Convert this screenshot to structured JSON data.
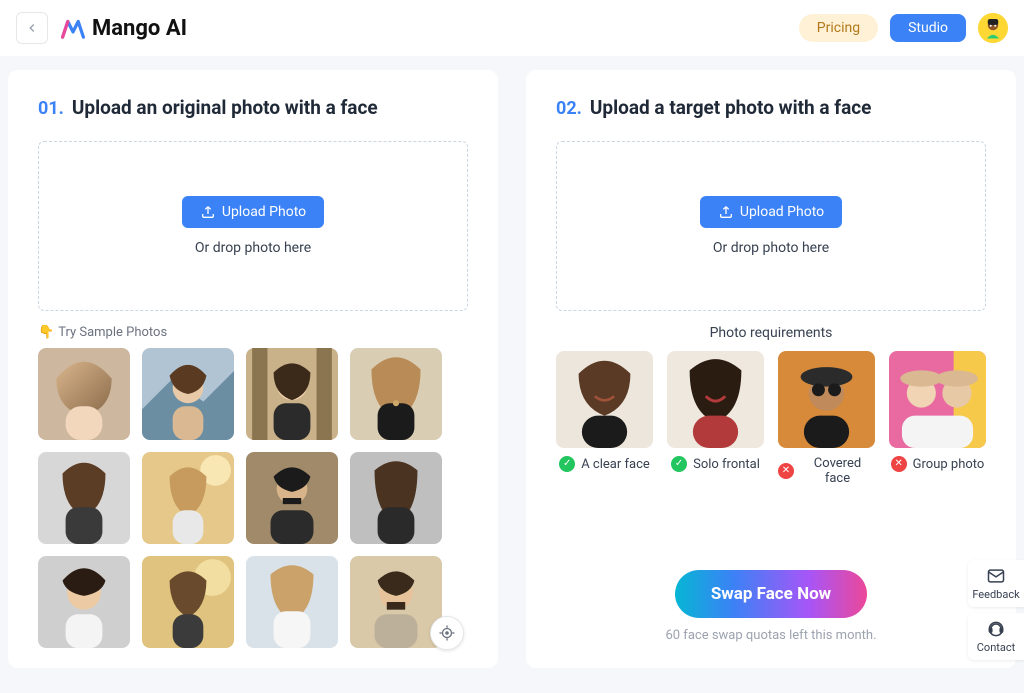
{
  "header": {
    "brand": "Mango AI",
    "pricing": "Pricing",
    "studio": "Studio"
  },
  "panel1": {
    "step": "01.",
    "title": "Upload an original photo with a face",
    "upload_label": "Upload Photo",
    "drop_label": "Or drop photo here",
    "sample_label": "Try Sample Photos"
  },
  "panel2": {
    "step": "02.",
    "title": "Upload a target photo with a face",
    "upload_label": "Upload Photo",
    "drop_label": "Or drop photo here",
    "req_label": "Photo requirements",
    "requirements": [
      {
        "label": "A clear face",
        "ok": true
      },
      {
        "label": "Solo frontal",
        "ok": true
      },
      {
        "label": "Covered face",
        "ok": false
      },
      {
        "label": "Group photo",
        "ok": false
      }
    ]
  },
  "cta": {
    "button": "Swap Face Now",
    "quota": "60 face swap quotas left this month."
  },
  "side": {
    "feedback": "Feedback",
    "contact": "Contact"
  }
}
